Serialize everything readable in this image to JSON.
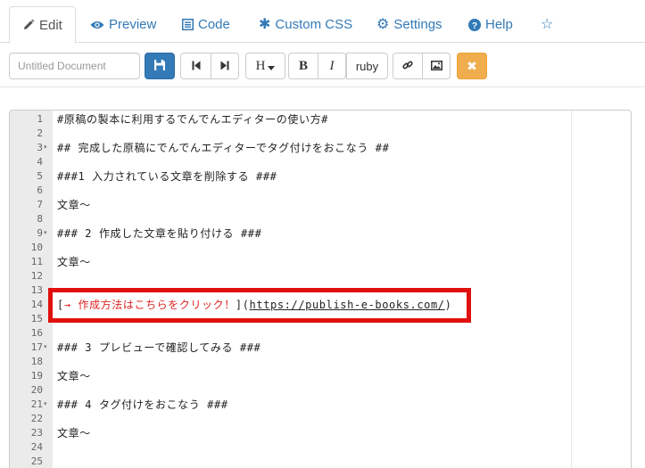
{
  "tabs": [
    {
      "label": "Edit",
      "icon": "pencil-icon",
      "active": true
    },
    {
      "label": "Preview",
      "icon": "eye-icon",
      "active": false
    },
    {
      "label": "Code",
      "icon": "code-list-icon",
      "active": false
    },
    {
      "label": "Custom CSS",
      "icon": "asterisk-icon",
      "active": false
    },
    {
      "label": "Settings",
      "icon": "gear-icon",
      "active": false
    },
    {
      "label": "Help",
      "icon": "question-circle-icon",
      "active": false
    },
    {
      "label": "",
      "icon": "star-icon",
      "active": false
    }
  ],
  "toolbar": {
    "doc_title_placeholder": "Untitled Document",
    "doc_title_value": "",
    "save_icon": "save-icon",
    "prev_icon": "step-backward-icon",
    "next_icon": "step-forward-icon",
    "heading_label": "H",
    "heading_caret_icon": "caret-down-icon",
    "bold_label": "B",
    "italic_label": "I",
    "ruby_label": "ruby",
    "link_icon": "link-icon",
    "image_icon": "image-icon",
    "close_icon": "close-icon"
  },
  "editor": {
    "lines": [
      {
        "n": "1",
        "text": "#原稿の製本に利用するでんでんエディターの使い方#",
        "fold": false
      },
      {
        "n": "2",
        "text": "",
        "fold": false
      },
      {
        "n": "3",
        "text": "## 完成した原稿にでんでんエディターでタグ付けをおこなう ##",
        "fold": true
      },
      {
        "n": "4",
        "text": "",
        "fold": false
      },
      {
        "n": "5",
        "text": "###1 入力されている文章を削除する ###",
        "fold": false
      },
      {
        "n": "6",
        "text": "",
        "fold": false
      },
      {
        "n": "7",
        "text": "文章～",
        "fold": false
      },
      {
        "n": "8",
        "text": "",
        "fold": false
      },
      {
        "n": "9",
        "text": "### 2 作成した文章を貼り付ける ###",
        "fold": true
      },
      {
        "n": "10",
        "text": "",
        "fold": false
      },
      {
        "n": "11",
        "text": "文章～",
        "fold": false
      },
      {
        "n": "12",
        "text": "",
        "fold": false
      },
      {
        "n": "13",
        "text": "",
        "fold": false
      },
      {
        "n": "14",
        "text": "",
        "fold": false,
        "link": true
      },
      {
        "n": "15",
        "text": "",
        "fold": false
      },
      {
        "n": "16",
        "text": "",
        "fold": false
      },
      {
        "n": "17",
        "text": "### 3 プレビューで確認してみる ###",
        "fold": true
      },
      {
        "n": "18",
        "text": "",
        "fold": false
      },
      {
        "n": "19",
        "text": "文章～",
        "fold": false
      },
      {
        "n": "20",
        "text": "",
        "fold": false
      },
      {
        "n": "21",
        "text": "### 4 タグ付けをおこなう ###",
        "fold": true
      },
      {
        "n": "22",
        "text": "",
        "fold": false
      },
      {
        "n": "23",
        "text": "文章～",
        "fold": false
      },
      {
        "n": "24",
        "text": "",
        "fold": false
      },
      {
        "n": "25",
        "text": "",
        "fold": false
      }
    ],
    "link_line": {
      "open_bracket": "[",
      "link_text": "→ 作成方法はこちらをクリック！",
      "mid": "](",
      "url": "https://publish-e-books.com/",
      "close": ")"
    }
  },
  "colors": {
    "accent": "#337ab7",
    "warning": "#f0ad4e",
    "highlight_border": "#e0100e",
    "link_text": "#dd2222"
  }
}
